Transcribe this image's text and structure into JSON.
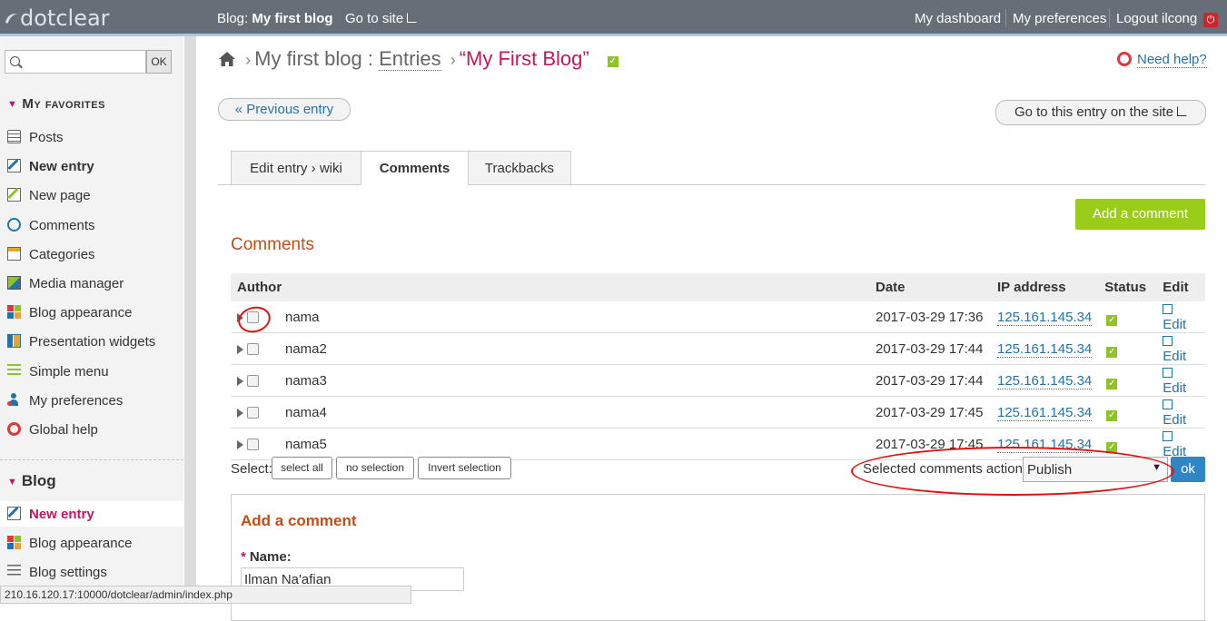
{
  "topbar": {
    "logo": "dotclear",
    "blog_prefix": "Blog:",
    "blog_name": "My first blog",
    "goto_site": "Go to site",
    "dashboard": "My dashboard",
    "preferences": "My preferences",
    "logout": "Logout ilcong"
  },
  "sidebar": {
    "search_placeholder": "",
    "search_ok": "OK",
    "favorites_title": "My favorites",
    "favorites": [
      {
        "label": "Posts",
        "icon": "posts-icon"
      },
      {
        "label": "New entry",
        "icon": "new-entry-icon"
      },
      {
        "label": "New page",
        "icon": "new-page-icon"
      },
      {
        "label": "Comments",
        "icon": "comments-icon"
      },
      {
        "label": "Categories",
        "icon": "categories-icon"
      },
      {
        "label": "Media manager",
        "icon": "media-icon"
      },
      {
        "label": "Blog appearance",
        "icon": "appearance-icon"
      },
      {
        "label": "Presentation widgets",
        "icon": "widgets-icon"
      },
      {
        "label": "Simple menu",
        "icon": "menu-icon"
      },
      {
        "label": "My preferences",
        "icon": "user-prefs-icon"
      },
      {
        "label": "Global help",
        "icon": "help-icon"
      }
    ],
    "blog_title": "Blog",
    "blog_items": [
      {
        "label": "New entry",
        "icon": "new-entry-icon"
      },
      {
        "label": "Blog appearance",
        "icon": "appearance-icon"
      },
      {
        "label": "Blog settings",
        "icon": "settings-icon"
      }
    ]
  },
  "status_url": "210.16.120.17:10000/dotclear/admin/index.php",
  "breadcrumb": {
    "blog": "My first blog",
    "colon": ":",
    "entries": "Entries",
    "current": "“My First Blog”"
  },
  "help_link": "Need help?",
  "prev_entry": "« Previous entry",
  "goto_entry": "Go to this entry on the site",
  "tabs": [
    "Edit entry › wiki",
    "Comments",
    "Trackbacks"
  ],
  "add_comment_button": "Add a comment",
  "comments_title": "Comments",
  "table": {
    "headers": {
      "author": "Author",
      "date": "Date",
      "ip": "IP address",
      "status": "Status",
      "edit": "Edit"
    },
    "rows": [
      {
        "author": "nama",
        "date": "2017-03-29 17:36",
        "ip": "125.161.145.34",
        "edit": "Edit"
      },
      {
        "author": "nama2",
        "date": "2017-03-29 17:44",
        "ip": "125.161.145.34",
        "edit": "Edit"
      },
      {
        "author": "nama3",
        "date": "2017-03-29 17:44",
        "ip": "125.161.145.34",
        "edit": "Edit"
      },
      {
        "author": "nama4",
        "date": "2017-03-29 17:45",
        "ip": "125.161.145.34",
        "edit": "Edit"
      },
      {
        "author": "nama5",
        "date": "2017-03-29 17:45",
        "ip": "125.161.145.34",
        "edit": "Edit"
      }
    ]
  },
  "selection": {
    "label": "Select:",
    "select_all": "select all",
    "no_selection": "no selection",
    "invert": "Invert selection",
    "action_label": "Selected comments action:",
    "action_value": "Publish",
    "ok": "ok"
  },
  "add_form": {
    "title": "Add a comment",
    "name_label": "Name:",
    "name_value": "Ilman Na'afian"
  },
  "colors": {
    "accent": "#c2185b",
    "green": "#9acd1a",
    "link": "#2373a8"
  }
}
